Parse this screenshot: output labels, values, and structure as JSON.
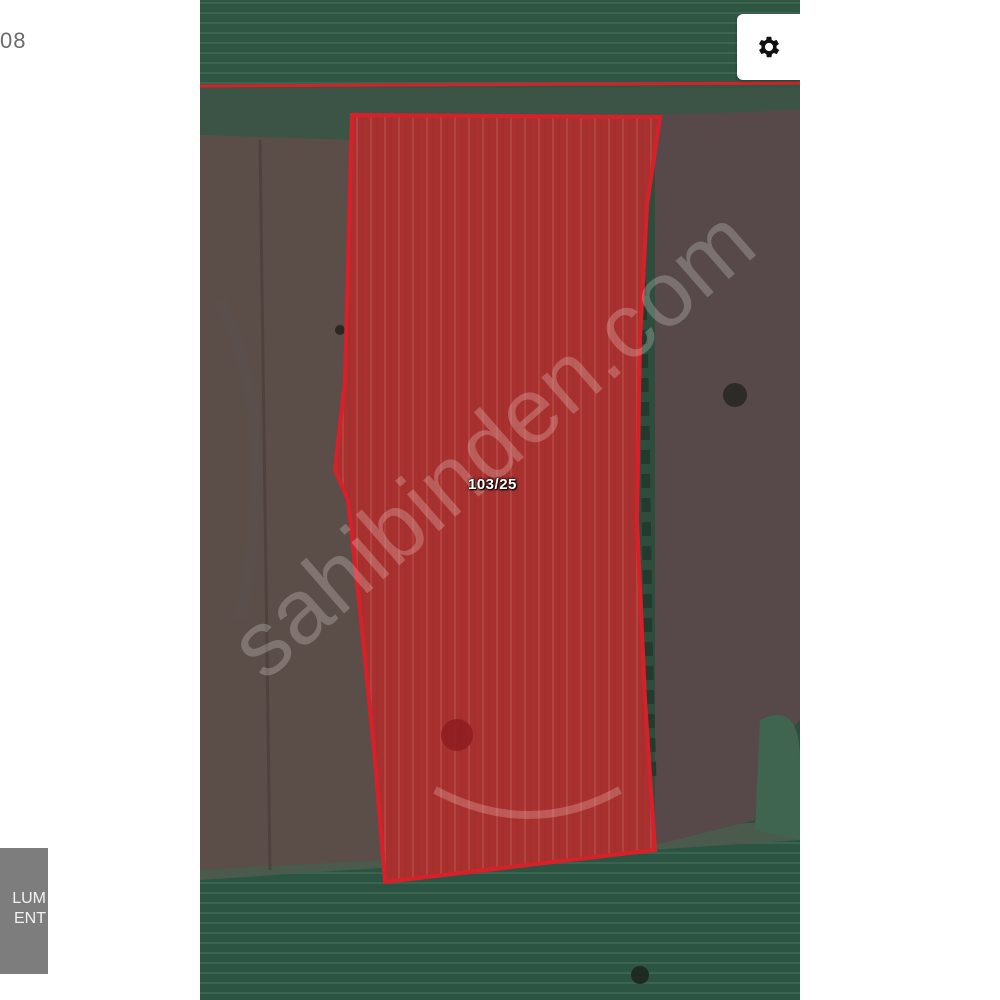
{
  "page": {
    "top_left_text": "08",
    "agent_card": {
      "line1": "LUM",
      "line2": "ENT"
    }
  },
  "map": {
    "parcel_label": "103/25",
    "watermark": "sahibinden.com",
    "boundary_color": "#d8202a",
    "parcel_fill_color": "#b0302e",
    "settings_icon": "gear-icon"
  }
}
